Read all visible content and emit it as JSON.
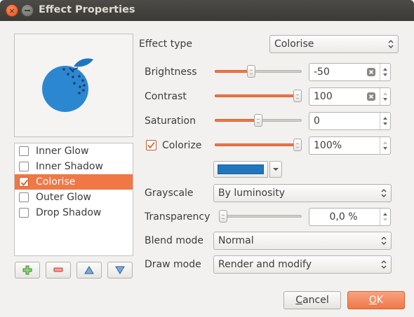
{
  "window": {
    "title": "Effect Properties",
    "close_glyph": "×"
  },
  "preview": {
    "icon": "orange-fruit-icon",
    "colors": {
      "fruit": "#2c87d1",
      "leaf": "#1f76bf",
      "dots": "#1a3e6b"
    }
  },
  "effects_list": {
    "items": [
      {
        "label": "Inner Glow",
        "checked": false,
        "selected": false
      },
      {
        "label": "Inner Shadow",
        "checked": false,
        "selected": false
      },
      {
        "label": "Colorise",
        "checked": true,
        "selected": true
      },
      {
        "label": "Outer Glow",
        "checked": false,
        "selected": false
      },
      {
        "label": "Drop Shadow",
        "checked": false,
        "selected": false
      }
    ],
    "buttons": [
      {
        "icon": "add-icon"
      },
      {
        "icon": "remove-icon"
      },
      {
        "icon": "move-up-icon"
      },
      {
        "icon": "move-down-icon"
      }
    ]
  },
  "form": {
    "effect_type": {
      "label": "Effect type",
      "value": "Colorise"
    },
    "brightness": {
      "label": "Brightness",
      "value": "-50",
      "slider_fraction": 0.41
    },
    "contrast": {
      "label": "Contrast",
      "value": "100",
      "slider_fraction": 1.0
    },
    "saturation": {
      "label": "Saturation",
      "value": "0",
      "slider_fraction": 0.5
    },
    "colorize": {
      "label": "Colorize",
      "checked": true,
      "value": "100%",
      "slider_fraction": 1.0,
      "color": "#2176be"
    },
    "grayscale": {
      "label": "Grayscale",
      "value": "By luminosity"
    },
    "transparency": {
      "label": "Transparency",
      "value": "0,0 %",
      "slider_fraction": 0.0
    },
    "blend_mode": {
      "label": "Blend mode",
      "value": "Normal"
    },
    "draw_mode": {
      "label": "Draw mode",
      "value": "Render and modify"
    }
  },
  "buttons": {
    "cancel": {
      "label_first": "C",
      "label_rest": "ancel"
    },
    "ok": {
      "label_first": "O",
      "label_rest": "K"
    }
  },
  "accent_color": "#f07746"
}
